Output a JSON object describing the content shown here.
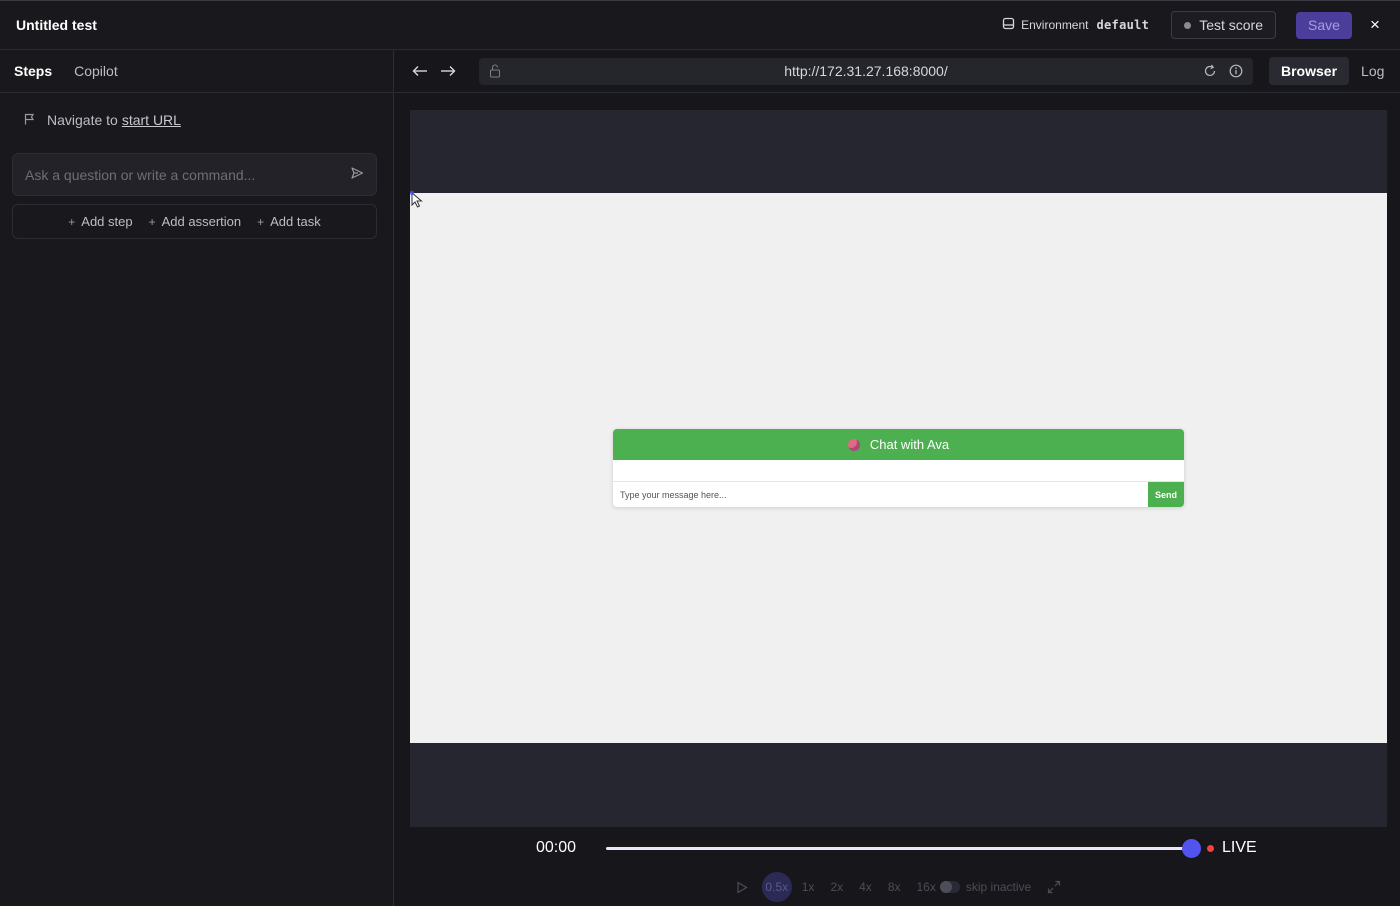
{
  "header": {
    "title": "Untitled test",
    "environment_label": "Environment",
    "environment_value": "default",
    "test_score_label": "Test score",
    "save_label": "Save",
    "close_label": "×"
  },
  "left": {
    "tabs": [
      {
        "label": "Steps",
        "active": true
      },
      {
        "label": "Copilot",
        "active": false
      }
    ],
    "step": {
      "prefix": "Navigate to",
      "link": "start URL"
    },
    "command": {
      "placeholder": "Ask a question or write a command..."
    },
    "add_actions": [
      "Add step",
      "Add assertion",
      "Add task"
    ]
  },
  "browser": {
    "url": "http://172.31.27.168:8000/",
    "views": [
      {
        "label": "Browser",
        "active": true
      },
      {
        "label": "Log",
        "active": false
      }
    ]
  },
  "page": {
    "chat_title": "Chat with Ava",
    "message_placeholder": "Type your message here...",
    "send_label": "Send",
    "brand_color": "#4caf50"
  },
  "player": {
    "time": "00:00",
    "live_label": "LIVE",
    "speeds": [
      "0.5x",
      "1x",
      "2x",
      "4x",
      "8x",
      "16x"
    ],
    "active_speed": "0.5x",
    "skip_label": "skip inactive",
    "progress": 1.0
  },
  "icons": {
    "env": "database-icon",
    "flag": "flag-icon",
    "send": "send-icon",
    "back": "arrow-left-icon",
    "forward": "arrow-right-icon",
    "lock": "unlock-icon",
    "reload": "reload-icon",
    "info": "info-icon",
    "play": "play-icon",
    "fullscreen": "expand-icon"
  },
  "colors": {
    "accent": "#5254f0",
    "save_bg": "#4b3d9a",
    "live": "#ef4444"
  }
}
